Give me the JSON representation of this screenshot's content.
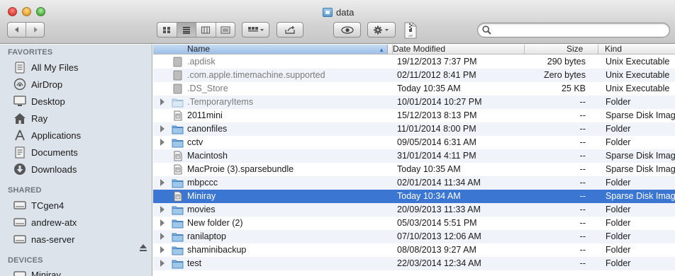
{
  "window": {
    "title": "data"
  },
  "toolbar": {
    "back_icon": "chevron-left-icon",
    "forward_icon": "chevron-right-icon",
    "view_modes": [
      "icon-view-icon",
      "list-view-icon",
      "column-view-icon",
      "coverflow-view-icon"
    ],
    "active_view": "list-view-icon",
    "search": {
      "value": "",
      "placeholder": ""
    }
  },
  "sidebar": {
    "favorites_heading": "FAVORITES",
    "favorites": [
      {
        "label": "All My Files",
        "icon": "all-my-files-icon"
      },
      {
        "label": "AirDrop",
        "icon": "airdrop-icon"
      },
      {
        "label": "Desktop",
        "icon": "desktop-icon"
      },
      {
        "label": "Ray",
        "icon": "home-icon"
      },
      {
        "label": "Applications",
        "icon": "applications-icon"
      },
      {
        "label": "Documents",
        "icon": "documents-icon"
      },
      {
        "label": "Downloads",
        "icon": "downloads-icon"
      }
    ],
    "shared_heading": "SHARED",
    "shared": [
      {
        "label": "TCgen4",
        "icon": "server-icon"
      },
      {
        "label": "andrew-atx",
        "icon": "server-icon"
      },
      {
        "label": "nas-server",
        "icon": "server-icon"
      }
    ],
    "devices_heading": "DEVICES",
    "devices": [
      {
        "label": "Miniray",
        "icon": "disk-icon"
      }
    ]
  },
  "list": {
    "columns": {
      "name": "Name",
      "date": "Date Modified",
      "size": "Size",
      "kind": "Kind"
    },
    "rows": [
      {
        "name": ".apdisk",
        "date": "19/12/2013 7:37 PM",
        "size": "290 bytes",
        "kind": "Unix Executable",
        "type": "file",
        "dim": true
      },
      {
        "name": ".com.apple.timemachine.supported",
        "date": "02/11/2012 8:41 PM",
        "size": "Zero bytes",
        "kind": "Unix Executable",
        "type": "file",
        "dim": true
      },
      {
        "name": ".DS_Store",
        "date": "Today 10:35 AM",
        "size": "25 KB",
        "kind": "Unix Executable",
        "type": "file",
        "dim": true
      },
      {
        "name": ".TemporaryItems",
        "date": "10/01/2014 10:27 PM",
        "size": "--",
        "kind": "Folder",
        "type": "folder",
        "dim": true
      },
      {
        "name": "2011mini",
        "date": "15/12/2013 8:13 PM",
        "size": "--",
        "kind": "Sparse Disk Imag",
        "type": "image"
      },
      {
        "name": "canonfiles",
        "date": "11/01/2014 8:00 PM",
        "size": "--",
        "kind": "Folder",
        "type": "folder"
      },
      {
        "name": "cctv",
        "date": "09/05/2014 6:31 AM",
        "size": "--",
        "kind": "Folder",
        "type": "folder"
      },
      {
        "name": "Macintosh",
        "date": "31/01/2014 4:11 PM",
        "size": "--",
        "kind": "Sparse Disk Imag",
        "type": "image"
      },
      {
        "name": "MacProie (3).sparsebundle",
        "date": "Today 10:35 AM",
        "size": "--",
        "kind": "Sparse Disk Imag",
        "type": "image"
      },
      {
        "name": "mbpccc",
        "date": "02/01/2014 11:34 AM",
        "size": "--",
        "kind": "Folder",
        "type": "folder"
      },
      {
        "name": "Miniray",
        "date": "Today 10:34 AM",
        "size": "--",
        "kind": "Sparse Disk Imag",
        "type": "image",
        "selected": true
      },
      {
        "name": "movies",
        "date": "20/09/2013 11:33 AM",
        "size": "--",
        "kind": "Folder",
        "type": "folder"
      },
      {
        "name": "New folder (2)",
        "date": "05/03/2014 5:51 PM",
        "size": "--",
        "kind": "Folder",
        "type": "folder"
      },
      {
        "name": "ranilaptop",
        "date": "07/10/2013 12:06 AM",
        "size": "--",
        "kind": "Folder",
        "type": "folder"
      },
      {
        "name": "shaminibackup",
        "date": "08/08/2013 9:27 AM",
        "size": "--",
        "kind": "Folder",
        "type": "folder"
      },
      {
        "name": "test",
        "date": "22/03/2014 12:34 AM",
        "size": "--",
        "kind": "Folder",
        "type": "folder"
      }
    ]
  },
  "colors": {
    "selection": "#3b76d2",
    "sidebar_bg": "#dde3ea",
    "alt_row": "#f0f4fa"
  }
}
